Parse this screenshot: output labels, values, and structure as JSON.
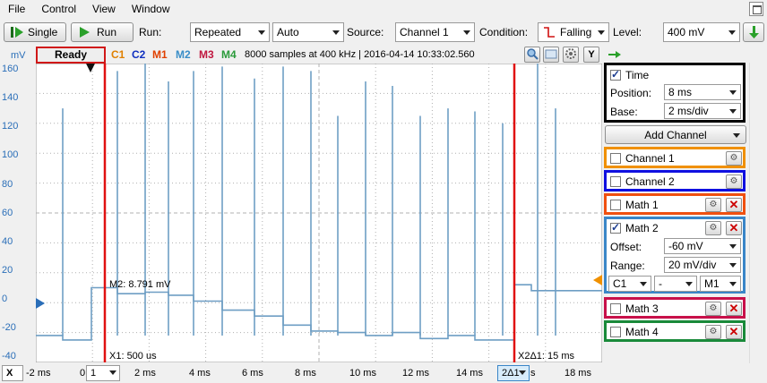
{
  "menu": [
    "File",
    "Control",
    "View",
    "Window"
  ],
  "toolbar": {
    "single_label": "Single",
    "run_btn_label": "Run",
    "run_label": "Run:",
    "run_mode": "Repeated",
    "trigger_mode": "Auto",
    "source_label": "Source:",
    "source_value": "Channel 1",
    "condition_label": "Condition:",
    "condition_value": "Falling",
    "level_label": "Level:",
    "level_value": "400 mV"
  },
  "status": {
    "state": "Ready",
    "channels": [
      {
        "name": "C1",
        "color": "#e08000"
      },
      {
        "name": "C2",
        "color": "#1030c0"
      },
      {
        "name": "M1",
        "color": "#e04000"
      },
      {
        "name": "M2",
        "color": "#3a8ec8"
      },
      {
        "name": "M3",
        "color": "#c01840"
      },
      {
        "name": "M4",
        "color": "#2a9a3a"
      }
    ],
    "samples_info": "8000 samples at 400 kHz | 2016-04-14 10:33:02.560",
    "y_button": "Y"
  },
  "axes": {
    "y_unit": "mV",
    "y_ticks": [
      "160",
      "140",
      "120",
      "100",
      "80",
      "60",
      "40",
      "20",
      "0",
      "-20",
      "-40"
    ],
    "x_ticks": [
      "-2 ms",
      "0",
      "2 ms",
      "4 ms",
      "6 ms",
      "8 ms",
      "10 ms",
      "12 ms",
      "14 ms",
      "s",
      "18 ms"
    ],
    "x_button": "X",
    "x_combo_1": "1",
    "x_combo_2": "2Δ1"
  },
  "cursors": {
    "m2_label": "M2: 8.791 mV",
    "x1_label": "X1: 500 us",
    "x2_label": "X2Δ1: 15 ms"
  },
  "panel": {
    "time": {
      "label": "Time",
      "position_label": "Position:",
      "position_value": "8 ms",
      "base_label": "Base:",
      "base_value": "2 ms/div"
    },
    "add_channel": "Add Channel",
    "channel1": {
      "label": "Channel 1",
      "color": "#f09000"
    },
    "channel2": {
      "label": "Channel 2",
      "color": "#1010e0"
    },
    "math1": {
      "label": "Math 1",
      "color": "#f05010"
    },
    "math2": {
      "label": "Math 2",
      "color": "#3a86c8",
      "offset_label": "Offset:",
      "offset_value": "-60 mV",
      "range_label": "Range:",
      "range_value": "20 mV/div",
      "op_a": "C1",
      "op": "-",
      "op_b": "M1"
    },
    "math3": {
      "label": "Math 3",
      "color": "#c8104a"
    },
    "math4": {
      "label": "Math 4",
      "color": "#1a8a3a"
    }
  },
  "trace_color": "#6e9ec4",
  "cursor_color": "#e01010"
}
